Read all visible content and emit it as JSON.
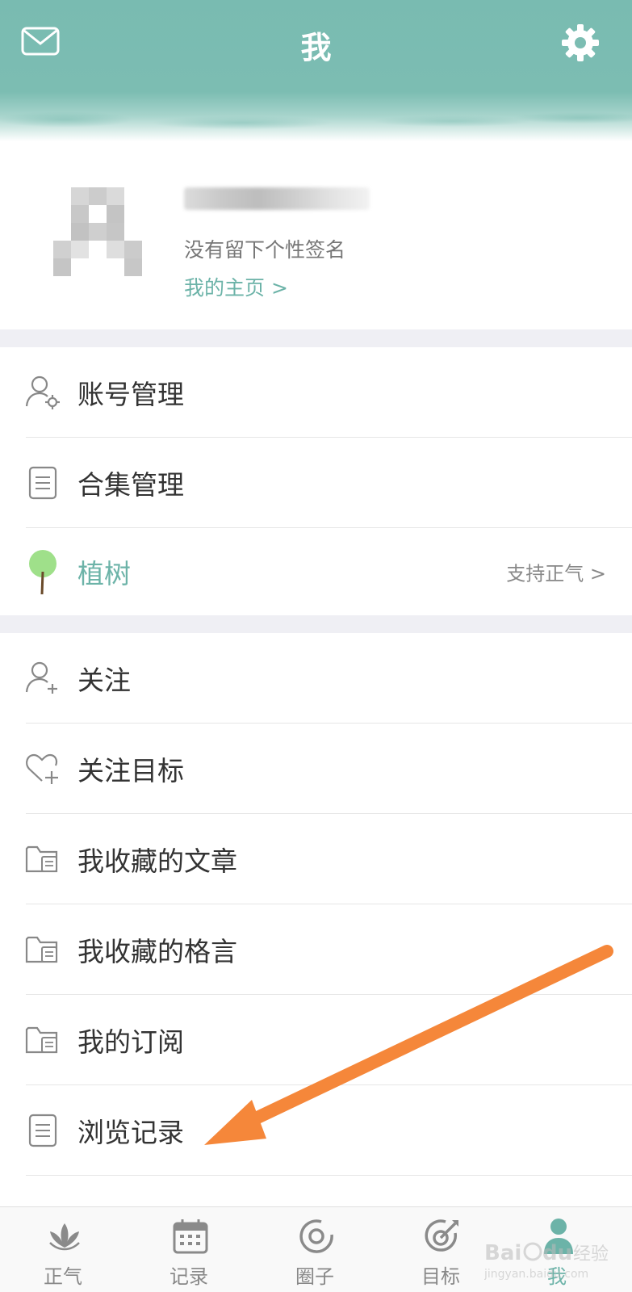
{
  "header": {
    "title": "我",
    "mail_icon": "mail-icon",
    "settings_icon": "gear-icon",
    "bg_color": "#79bbb1"
  },
  "profile": {
    "signature": "没有留下个性签名",
    "home_link": "我的主页 >"
  },
  "menu_group_1": [
    {
      "label": "账号管理",
      "icon": "user-gear-icon"
    },
    {
      "label": "合集管理",
      "icon": "document-icon"
    },
    {
      "label": "植树",
      "icon": "tree-icon",
      "right_text": "支持正气 >"
    }
  ],
  "menu_group_2": [
    {
      "label": "关注",
      "icon": "user-add-icon"
    },
    {
      "label": "关注目标",
      "icon": "heart-add-icon"
    },
    {
      "label": "我收藏的文章",
      "icon": "folder-icon"
    },
    {
      "label": "我收藏的格言",
      "icon": "folder-icon"
    },
    {
      "label": "我的订阅",
      "icon": "folder-icon"
    },
    {
      "label": "浏览记录",
      "icon": "document-icon"
    }
  ],
  "tabs": [
    {
      "label": "正气",
      "icon": "lotus-icon"
    },
    {
      "label": "记录",
      "icon": "calendar-icon"
    },
    {
      "label": "圈子",
      "icon": "circle-icon"
    },
    {
      "label": "目标",
      "icon": "target-icon"
    },
    {
      "label": "我",
      "icon": "person-icon",
      "active": true
    }
  ],
  "colors": {
    "accent": "#6cb3a8",
    "annotation_arrow": "#f5873a"
  }
}
